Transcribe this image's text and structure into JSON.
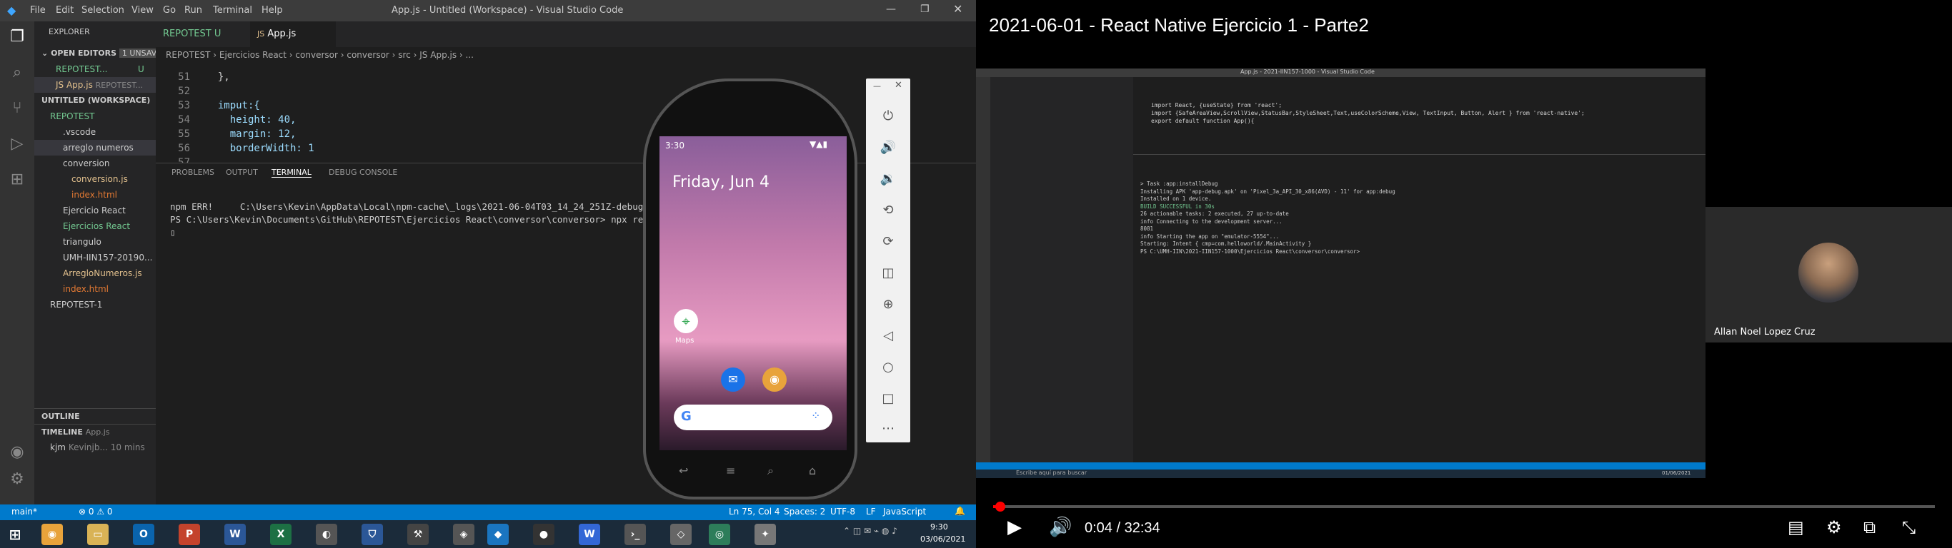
{
  "vscode": {
    "window_title": "App.js - Untitled (Workspace) - Visual Studio Code",
    "menu": [
      "File",
      "Edit",
      "Selection",
      "View",
      "Go",
      "Run",
      "Terminal",
      "Help"
    ],
    "explorer_title": "EXPLORER",
    "open_editors": {
      "label": "OPEN EDITORS",
      "badge": "1 UNSAVED",
      "items": [
        {
          "name": "REPOTEST...",
          "status": "U"
        },
        {
          "name": "JS App.js",
          "path": "REPOTEST..."
        }
      ]
    },
    "workspace": {
      "label": "UNTITLED (WORKSPACE)",
      "root": "REPOTEST",
      "items": [
        ".vscode",
        "arreglo numeros",
        "conversion",
        "conversion.js",
        "index.html",
        "Ejercicio React",
        "Ejercicios React",
        "triangulo",
        "UMH-IIN157-20190...",
        "ArregloNumeros.js",
        "index.html",
        "REPOTEST-1"
      ]
    },
    "outline_label": "OUTLINE",
    "timeline_label": "TIMELINE",
    "timeline_file": "App.js",
    "timeline_entry": {
      "name": "kjm",
      "author": "Kevinjb...",
      "time": "10 mins"
    },
    "tabs": [
      {
        "label": "REPOTEST",
        "status": "U"
      },
      {
        "label": "App.js"
      }
    ],
    "breadcrumb": [
      "REPOTEST",
      "Ejercicios React",
      "conversor",
      "conversor",
      "src",
      "JS App.js",
      "..."
    ],
    "code_lines": [
      {
        "n": "51",
        "text": "  },"
      },
      {
        "n": "52",
        "text": ""
      },
      {
        "n": "53",
        "text": "  imput:{"
      },
      {
        "n": "54",
        "text": "    height: 40,"
      },
      {
        "n": "55",
        "text": "    margin: 12,"
      },
      {
        "n": "56",
        "text": "    borderWidth: 1"
      },
      {
        "n": "57",
        "text": ""
      }
    ],
    "panel_tabs": [
      "PROBLEMS",
      "OUTPUT",
      "TERMINAL",
      "DEBUG CONSOLE"
    ],
    "terminal_lines": [
      "npm ERR!     C:\\Users\\Kevin\\AppData\\Local\\npm-cache\\_logs\\2021-06-04T03_14_24_251Z-debug.log",
      "PS C:\\Users\\Kevin\\Documents\\GitHub\\REPOTEST\\Ejercicios React\\conversor\\conversor> npx react-na"
    ],
    "status_left": [
      "main*",
      "⊗ 0 ⚠ 0"
    ],
    "status_right": [
      "Ln 75, Col 4",
      "Spaces: 2",
      "UTF-8",
      "LF",
      "JavaScript"
    ],
    "taskbar_time": "9:30",
    "taskbar_date": "03/06/2021"
  },
  "emulator": {
    "status_time": "3:30",
    "date_text": "Friday, Jun 4",
    "maps_label": "Maps",
    "search_logo": "G"
  },
  "youtube": {
    "video_title": "2021-06-01 - React Native Ejercicio 1 - Parte2",
    "current_time": "0:04",
    "duration": "32:34",
    "time_separator": "/",
    "progress_fraction": 0.002,
    "participant_name": "Allan Noel Lopez Cruz",
    "inner_window_title": "App.js - 2021-IIN157-1000 - Visual Studio Code",
    "inner_terminal_lines": [
      "> Task :app:installDebug",
      "Installing APK 'app-debug.apk' on 'Pixel_3a_API_30_x86(AVD) - 11' for app:debug",
      "Installed on 1 device.",
      "",
      "BUILD SUCCESSFUL in 30s",
      "26 actionable tasks: 2 executed, 27 up-to-date",
      "info Connecting to the development server...",
      "8081",
      "info Starting the app on \"emulator-5554\"...",
      "Starting: Intent { cmp=com.helloworld/.MainActivity }",
      "PS C:\\UMH-IIN\\2021-IIN157-1000\\Ejercicios React\\conversor\\conversor>"
    ],
    "inner_code_lines": [
      "import React, {useState} from 'react';",
      "import {SafeAreaView,ScrollView,StatusBar,StyleSheet,Text,useColorScheme,View, TextInput, Button, Alert } from 'react-native';",
      "",
      "export default function App(){"
    ],
    "inner_taskbar_search": "Escribe aquí para buscar",
    "inner_date": "01/06/2021"
  }
}
